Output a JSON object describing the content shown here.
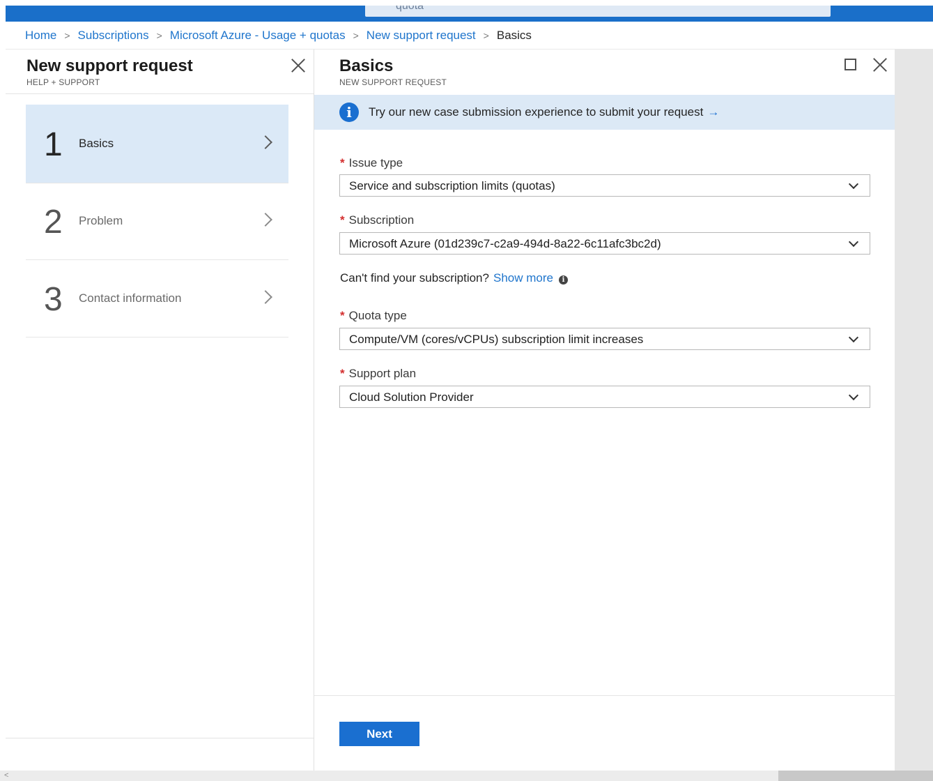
{
  "topbar": {
    "search_text": "quota"
  },
  "breadcrumb": [
    {
      "label": "Home"
    },
    {
      "label": "Subscriptions"
    },
    {
      "label": "Microsoft Azure - Usage + quotas"
    },
    {
      "label": "New support request"
    },
    {
      "label": "Basics"
    }
  ],
  "left_blade": {
    "title": "New support request",
    "subtitle": "HELP + SUPPORT",
    "steps": [
      {
        "number": "1",
        "label": "Basics",
        "state": "active"
      },
      {
        "number": "2",
        "label": "Problem",
        "state": "inactive"
      },
      {
        "number": "3",
        "label": "Contact information",
        "state": "inactive"
      }
    ]
  },
  "right_blade": {
    "title": "Basics",
    "subtitle": "NEW SUPPORT REQUEST",
    "banner": {
      "text": "Try our new case submission experience to submit your request",
      "arrow": "→"
    },
    "fields": {
      "issue_type": {
        "label": "Issue type",
        "value": "Service and subscription limits (quotas)"
      },
      "subscription": {
        "label": "Subscription",
        "value": "Microsoft Azure (01d239c7-c2a9-494d-8a22-6c11afc3bc2d)"
      },
      "quota_type": {
        "label": "Quota type",
        "value": "Compute/VM (cores/vCPUs) subscription limit increases"
      },
      "support_plan": {
        "label": "Support plan",
        "value": "Cloud Solution Provider"
      }
    },
    "help": {
      "text": "Can't find your subscription?",
      "link": "Show more"
    },
    "next_button": "Next"
  },
  "colors": {
    "accent": "#1a6fd0",
    "link": "#1f75cc",
    "active_step_bg": "#dbe9f7",
    "banner_bg": "#dce9f6",
    "required": "#d32e2e"
  },
  "icons": [
    "close-icon",
    "maximize-icon",
    "info-icon",
    "chevron-right-icon",
    "chevron-down-icon"
  ]
}
